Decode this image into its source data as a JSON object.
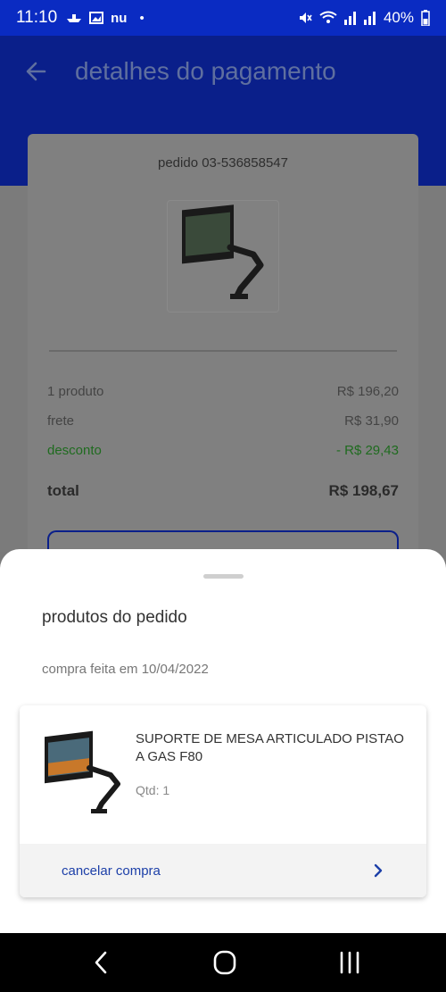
{
  "status_bar": {
    "time": "11:10",
    "left_icons": [
      "boat-icon",
      "gallery-icon",
      "nu"
    ],
    "dot": "•",
    "battery": "40%"
  },
  "header": {
    "title": "detalhes do pagamento",
    "back_icon": "arrow-left-icon"
  },
  "order": {
    "id_label": "pedido 03-536858547",
    "product_image": "monitor-arm-icon",
    "summary": [
      {
        "label": "1 produto",
        "value": "R$ 196,20"
      },
      {
        "label": "frete",
        "value": "R$ 31,90"
      },
      {
        "label": "desconto",
        "value": "- R$ 29,43"
      },
      {
        "label": "total",
        "value": "R$ 198,67"
      }
    ]
  },
  "sheet": {
    "title": "produtos do pedido",
    "purchase_date": "compra feita em 10/04/2022",
    "product": {
      "name": "SUPORTE DE MESA ARTICULADO PISTAO A GAS F80",
      "qty": "Qtd: 1"
    },
    "cancel_label": "cancelar compra"
  },
  "colors": {
    "brand_blue": "#0a2bc2",
    "discount_green": "#1f6b1f",
    "link_blue": "#1c3fa8"
  }
}
